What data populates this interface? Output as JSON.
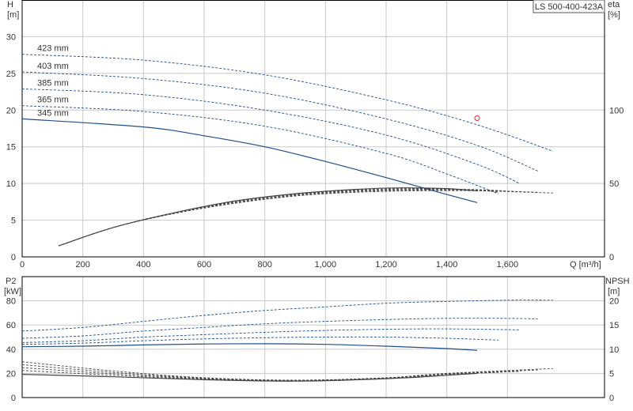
{
  "colors": {
    "curve_blue": "#1f4e8c",
    "eff_dark": "#444444",
    "grid": "#c8c8c8",
    "frame": "#000000",
    "text": "#333333",
    "duty_point": "#e0303a"
  },
  "model": "LS 500-400-423A",
  "chart_data": [
    {
      "type": "line",
      "panel": "upper",
      "y_left": {
        "label": "H",
        "unit": "[m]",
        "lim": [
          0,
          35
        ],
        "ticks": [
          0,
          5,
          10,
          15,
          20,
          25,
          30
        ]
      },
      "y_right": {
        "label": "eta",
        "unit": "[%]",
        "lim": [
          0,
          175
        ],
        "ticks": [
          0,
          50,
          100
        ]
      },
      "x": {
        "label": "Q [m³/h]",
        "lim": [
          0,
          1920
        ],
        "ticks": [
          0,
          200,
          400,
          600,
          800,
          1000,
          1200,
          1400,
          1600
        ],
        "tick_labels": [
          "0",
          "200",
          "400",
          "600",
          "800",
          "1,000",
          "1,200",
          "1,400",
          "1,600"
        ]
      },
      "grid": true,
      "head_series": [
        {
          "name": "423 mm",
          "dashed": true,
          "points": [
            [
              0,
              27.6
            ],
            [
              400,
              26.8
            ],
            [
              800,
              24.8
            ],
            [
              1200,
              21.4
            ],
            [
              1500,
              18.0
            ],
            [
              1750,
              14.4
            ]
          ]
        },
        {
          "name": "403 mm",
          "dashed": true,
          "points": [
            [
              0,
              25.2
            ],
            [
              400,
              24.3
            ],
            [
              800,
              22.3
            ],
            [
              1200,
              18.8
            ],
            [
              1500,
              15.2
            ],
            [
              1700,
              11.7
            ]
          ]
        },
        {
          "name": "385 mm",
          "dashed": true,
          "points": [
            [
              0,
              22.9
            ],
            [
              400,
              22.1
            ],
            [
              800,
              20.0
            ],
            [
              1200,
              16.6
            ],
            [
              1500,
              12.6
            ],
            [
              1640,
              10.0
            ]
          ]
        },
        {
          "name": "365 mm",
          "dashed": true,
          "points": [
            [
              0,
              20.6
            ],
            [
              400,
              19.8
            ],
            [
              800,
              17.8
            ],
            [
              1200,
              14.1
            ],
            [
              1400,
              11.3
            ],
            [
              1570,
              8.6
            ]
          ]
        },
        {
          "name": "345 mm",
          "dashed": false,
          "points": [
            [
              0,
              18.8
            ],
            [
              400,
              17.7
            ],
            [
              600,
              16.5
            ],
            [
              800,
              15.0
            ],
            [
              1000,
              13.0
            ],
            [
              1200,
              10.8
            ],
            [
              1400,
              8.5
            ],
            [
              1500,
              7.4
            ]
          ]
        }
      ],
      "efficiency_series": [
        {
          "dashed": false,
          "points": [
            [
              120,
              7.5
            ],
            [
              300,
              20
            ],
            [
              500,
              30
            ],
            [
              700,
              38
            ],
            [
              900,
              43
            ],
            [
              1100,
              46
            ],
            [
              1250,
              47
            ],
            [
              1400,
              46.5
            ],
            [
              1500,
              45
            ]
          ]
        },
        {
          "dashed": true,
          "points": [
            [
              120,
              7.5
            ],
            [
              300,
              20
            ],
            [
              500,
              30
            ],
            [
              700,
              37.5
            ],
            [
              900,
              42.5
            ],
            [
              1100,
              45.5
            ],
            [
              1300,
              46.5
            ],
            [
              1500,
              45.5
            ],
            [
              1570,
              44
            ]
          ]
        },
        {
          "dashed": true,
          "points": [
            [
              120,
              7.5
            ],
            [
              300,
              20
            ],
            [
              500,
              30
            ],
            [
              700,
              37
            ],
            [
              900,
              42
            ],
            [
              1100,
              45
            ],
            [
              1300,
              46
            ],
            [
              1500,
              45.8
            ],
            [
              1640,
              44.3
            ]
          ]
        },
        {
          "dashed": true,
          "points": [
            [
              120,
              7.5
            ],
            [
              300,
              20
            ],
            [
              500,
              29.5
            ],
            [
              700,
              36.5
            ],
            [
              900,
              41.5
            ],
            [
              1100,
              44.5
            ],
            [
              1300,
              45.5
            ],
            [
              1500,
              45.3
            ],
            [
              1700,
              44
            ]
          ]
        },
        {
          "dashed": true,
          "points": [
            [
              120,
              7.5
            ],
            [
              300,
              20
            ],
            [
              500,
              29.5
            ],
            [
              700,
              36.5
            ],
            [
              900,
              41.5
            ],
            [
              1100,
              44
            ],
            [
              1300,
              45
            ],
            [
              1500,
              45
            ],
            [
              1750,
              43.5
            ]
          ]
        }
      ],
      "duty_point": {
        "q": 1500,
        "h": 18.9
      }
    },
    {
      "type": "line",
      "panel": "lower",
      "y_left": {
        "label": "P2",
        "unit": "[kW]",
        "lim": [
          0,
          100
        ],
        "ticks": [
          0,
          20,
          40,
          60,
          80
        ]
      },
      "y_right": {
        "label": "NPSH",
        "unit": "[m]",
        "lim": [
          0,
          25
        ],
        "ticks": [
          0,
          5,
          10,
          15,
          20
        ]
      },
      "x": {
        "lim": [
          0,
          1920
        ]
      },
      "grid": true,
      "power_series": [
        {
          "dashed": true,
          "points": [
            [
              0,
              55
            ],
            [
              200,
              58
            ],
            [
              400,
              63
            ],
            [
              600,
              68
            ],
            [
              800,
              72
            ],
            [
              1000,
              75
            ],
            [
              1200,
              78
            ],
            [
              1400,
              79.5
            ],
            [
              1600,
              80.5
            ],
            [
              1750,
              80.5
            ]
          ]
        },
        {
          "dashed": true,
          "points": [
            [
              0,
              49
            ],
            [
              200,
              51
            ],
            [
              400,
              55
            ],
            [
              600,
              58
            ],
            [
              800,
              61
            ],
            [
              1000,
              63
            ],
            [
              1200,
              64.5
            ],
            [
              1400,
              65.5
            ],
            [
              1600,
              65.5
            ],
            [
              1700,
              65
            ]
          ]
        },
        {
          "dashed": true,
          "points": [
            [
              0,
              45.5
            ],
            [
              200,
              47
            ],
            [
              400,
              50
            ],
            [
              600,
              52
            ],
            [
              800,
              54
            ],
            [
              1000,
              55.5
            ],
            [
              1200,
              56.5
            ],
            [
              1400,
              56.8
            ],
            [
              1640,
              56
            ]
          ]
        },
        {
          "dashed": true,
          "points": [
            [
              0,
              44
            ],
            [
              200,
              45
            ],
            [
              400,
              47
            ],
            [
              600,
              48.5
            ],
            [
              800,
              49.5
            ],
            [
              1000,
              50
            ],
            [
              1200,
              50
            ],
            [
              1400,
              49
            ],
            [
              1570,
              47.5
            ]
          ]
        },
        {
          "dashed": false,
          "points": [
            [
              0,
              42
            ],
            [
              200,
              42.5
            ],
            [
              400,
              43.5
            ],
            [
              600,
              44.3
            ],
            [
              800,
              44.5
            ],
            [
              1000,
              44
            ],
            [
              1200,
              42.5
            ],
            [
              1400,
              40.5
            ],
            [
              1500,
              39
            ]
          ]
        }
      ],
      "npsh_series": [
        {
          "dashed": false,
          "points": [
            [
              0,
              4.8
            ],
            [
              300,
              4.3
            ],
            [
              600,
              3.7
            ],
            [
              900,
              3.4
            ],
            [
              1200,
              3.9
            ],
            [
              1400,
              4.6
            ],
            [
              1500,
              5.0
            ]
          ]
        },
        {
          "dashed": true,
          "points": [
            [
              0,
              5.6
            ],
            [
              300,
              4.6
            ],
            [
              600,
              3.8
            ],
            [
              900,
              3.5
            ],
            [
              1200,
              4.0
            ],
            [
              1400,
              4.8
            ],
            [
              1570,
              5.2
            ]
          ]
        },
        {
          "dashed": true,
          "points": [
            [
              0,
              6.2
            ],
            [
              300,
              4.9
            ],
            [
              600,
              3.9
            ],
            [
              900,
              3.5
            ],
            [
              1200,
              4.0
            ],
            [
              1400,
              4.8
            ],
            [
              1640,
              5.4
            ]
          ]
        },
        {
          "dashed": true,
          "points": [
            [
              0,
              6.8
            ],
            [
              300,
              5.2
            ],
            [
              600,
              4.0
            ],
            [
              900,
              3.6
            ],
            [
              1200,
              4.0
            ],
            [
              1400,
              4.9
            ],
            [
              1700,
              5.7
            ]
          ]
        },
        {
          "dashed": true,
          "points": [
            [
              0,
              7.4
            ],
            [
              300,
              5.5
            ],
            [
              600,
              4.1
            ],
            [
              900,
              3.6
            ],
            [
              1200,
              4.1
            ],
            [
              1400,
              5.0
            ],
            [
              1750,
              6.0
            ]
          ]
        }
      ]
    }
  ]
}
